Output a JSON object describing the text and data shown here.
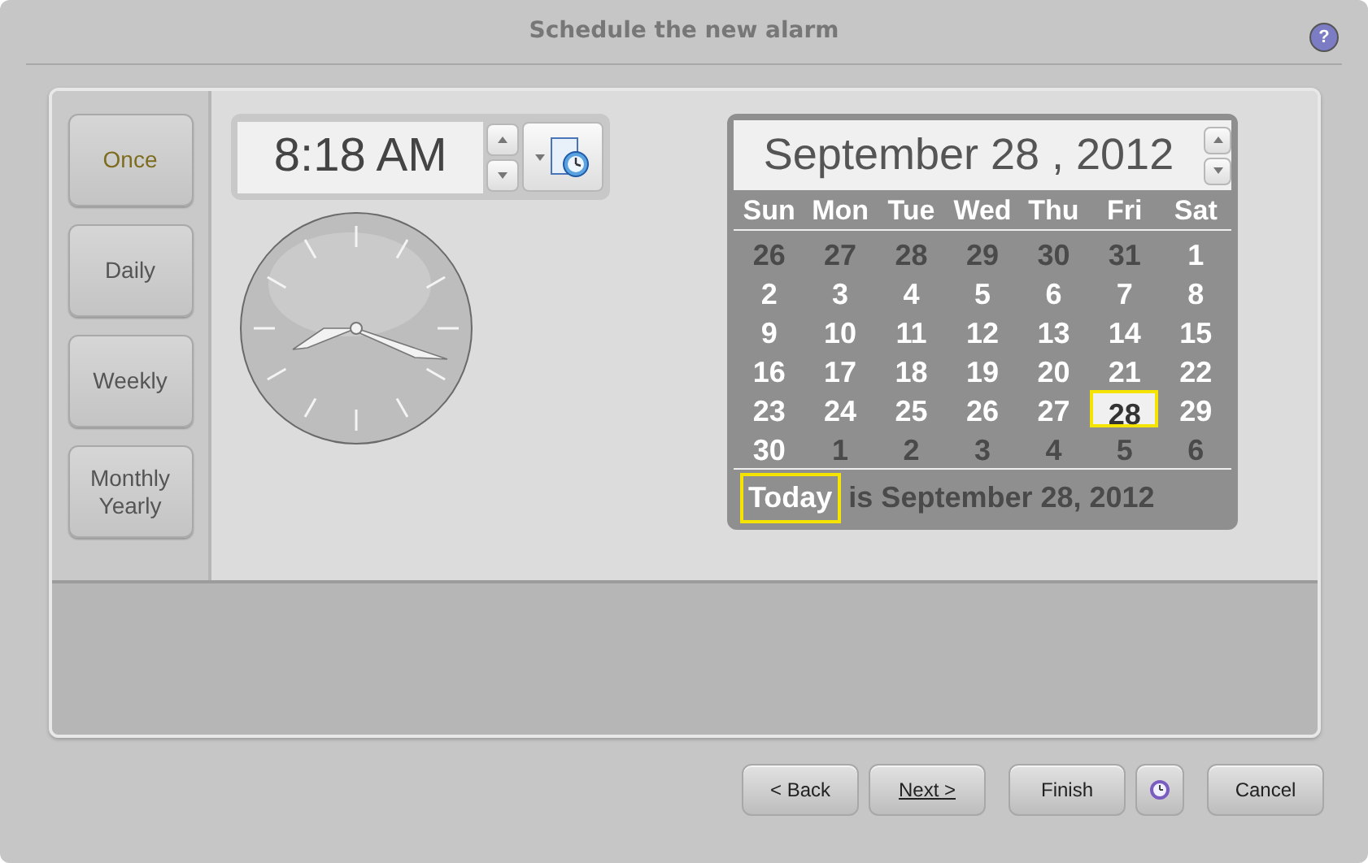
{
  "window": {
    "title": "Schedule the new alarm",
    "help": "?"
  },
  "frequency": [
    {
      "label": "Once",
      "selected": true
    },
    {
      "label": "Daily",
      "selected": false
    },
    {
      "label": "Weekly",
      "selected": false
    },
    {
      "label": "Monthly Yearly",
      "selected": false
    }
  ],
  "time": {
    "value": "8:18 AM"
  },
  "calendar": {
    "title": "September 28 , 2012",
    "weekdays": [
      "Sun",
      "Mon",
      "Tue",
      "Wed",
      "Thu",
      "Fri",
      "Sat"
    ],
    "days": [
      {
        "label": "26",
        "other_month": true,
        "selected": false
      },
      {
        "label": "27",
        "other_month": true,
        "selected": false
      },
      {
        "label": "28",
        "other_month": true,
        "selected": false
      },
      {
        "label": "29",
        "other_month": true,
        "selected": false
      },
      {
        "label": "30",
        "other_month": true,
        "selected": false
      },
      {
        "label": "31",
        "other_month": true,
        "selected": false
      },
      {
        "label": "1",
        "other_month": false,
        "selected": false
      },
      {
        "label": "2",
        "other_month": false,
        "selected": false
      },
      {
        "label": "3",
        "other_month": false,
        "selected": false
      },
      {
        "label": "4",
        "other_month": false,
        "selected": false
      },
      {
        "label": "5",
        "other_month": false,
        "selected": false
      },
      {
        "label": "6",
        "other_month": false,
        "selected": false
      },
      {
        "label": "7",
        "other_month": false,
        "selected": false
      },
      {
        "label": "8",
        "other_month": false,
        "selected": false
      },
      {
        "label": "9",
        "other_month": false,
        "selected": false
      },
      {
        "label": "10",
        "other_month": false,
        "selected": false
      },
      {
        "label": "11",
        "other_month": false,
        "selected": false
      },
      {
        "label": "12",
        "other_month": false,
        "selected": false
      },
      {
        "label": "13",
        "other_month": false,
        "selected": false
      },
      {
        "label": "14",
        "other_month": false,
        "selected": false
      },
      {
        "label": "15",
        "other_month": false,
        "selected": false
      },
      {
        "label": "16",
        "other_month": false,
        "selected": false
      },
      {
        "label": "17",
        "other_month": false,
        "selected": false
      },
      {
        "label": "18",
        "other_month": false,
        "selected": false
      },
      {
        "label": "19",
        "other_month": false,
        "selected": false
      },
      {
        "label": "20",
        "other_month": false,
        "selected": false
      },
      {
        "label": "21",
        "other_month": false,
        "selected": false
      },
      {
        "label": "22",
        "other_month": false,
        "selected": false
      },
      {
        "label": "23",
        "other_month": false,
        "selected": false
      },
      {
        "label": "24",
        "other_month": false,
        "selected": false
      },
      {
        "label": "25",
        "other_month": false,
        "selected": false
      },
      {
        "label": "26",
        "other_month": false,
        "selected": false
      },
      {
        "label": "27",
        "other_month": false,
        "selected": false
      },
      {
        "label": "28",
        "other_month": false,
        "selected": true
      },
      {
        "label": "29",
        "other_month": false,
        "selected": false
      },
      {
        "label": "30",
        "other_month": false,
        "selected": false
      },
      {
        "label": "1",
        "other_month": true,
        "selected": false
      },
      {
        "label": "2",
        "other_month": true,
        "selected": false
      },
      {
        "label": "3",
        "other_month": true,
        "selected": false
      },
      {
        "label": "4",
        "other_month": true,
        "selected": false
      },
      {
        "label": "5",
        "other_month": true,
        "selected": false
      },
      {
        "label": "6",
        "other_month": true,
        "selected": false
      }
    ],
    "today_button": "Today",
    "today_text": "is September 28, 2012"
  },
  "buttons": [
    {
      "label": "< Back",
      "kind": "text"
    },
    {
      "label": "Next >",
      "kind": "underlined"
    },
    {
      "label": "Finish",
      "kind": "text"
    },
    {
      "kind": "icon"
    },
    {
      "label": "Cancel",
      "kind": "text"
    }
  ]
}
